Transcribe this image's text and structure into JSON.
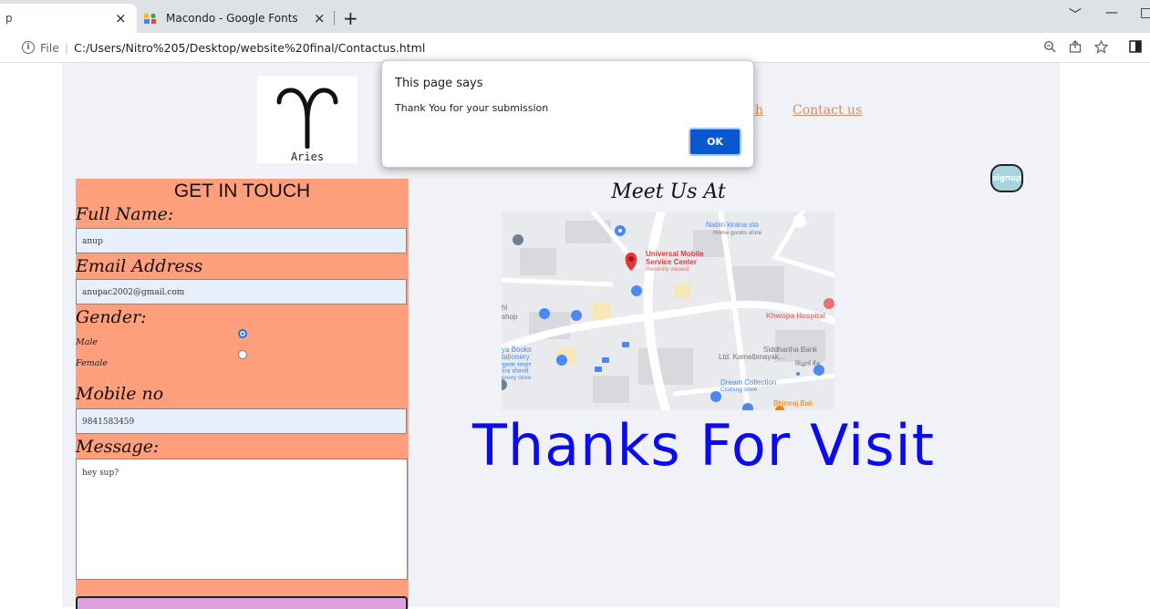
{
  "browser": {
    "tabs": [
      {
        "label": "p",
        "close": "×"
      },
      {
        "label": "Macondo - Google Fonts",
        "close": "×"
      }
    ],
    "new_tab": "+",
    "url_scheme": "File",
    "url": "C:/Users/Nitro%205/Desktop/website%20final/Contactus.html",
    "window_controls": [
      "﹀",
      "—",
      "□"
    ]
  },
  "header": {
    "logo_label": "Aries",
    "nav_partial": "h",
    "nav_contact": "Contact us",
    "signup": "signup"
  },
  "form": {
    "title": "GET IN TOUCH",
    "full_name_label": "Full Name:",
    "full_name_value": "anup",
    "email_label": "Email Address",
    "email_value": "anupac2002@gmail.com",
    "gender_label": "Gender:",
    "gender_options": [
      {
        "label": "Male",
        "checked": true
      },
      {
        "label": "Female",
        "checked": false
      }
    ],
    "mobile_label": "Mobile no",
    "mobile_value": "9841583459",
    "message_label": "Message:",
    "message_value": "hey sup?"
  },
  "main": {
    "meet_title": "Meet Us At",
    "map_labels": {
      "store": "Nabin kirana sto",
      "store_sub": "Home goods store",
      "service": "Universal Mobile",
      "service2": "Service Center",
      "service_sub": "Recently viewed",
      "hospital": "Khwopa Hospital",
      "shop": "shop",
      "shop_prefix": "hi",
      "books": "ya Books",
      "books2": "tationery",
      "books3": "पुस्तक भण्डार",
      "books4": "एन्ड स्टेशनरी",
      "books5": "onery store",
      "bank": "Siddhartha Bank",
      "bank2": "Ltd. Kamalbinayak...",
      "bank3": "सिद्धार्थ बैंक",
      "dream": "Dream Collection",
      "dream_sub": "Clothing store",
      "bhimraj": "Bhimraj Bak"
    },
    "thanks": "Thanks For Visit"
  },
  "dialog": {
    "title": "This page says",
    "message": "Thank You for your submission",
    "ok": "OK"
  },
  "colors": {
    "form_bg": "#ff9f7b",
    "page_bg": "#f0f2f8",
    "thanks": "#0b0bf0",
    "nav_link": "#d28c5e",
    "ok_button": "#0b57d0"
  }
}
